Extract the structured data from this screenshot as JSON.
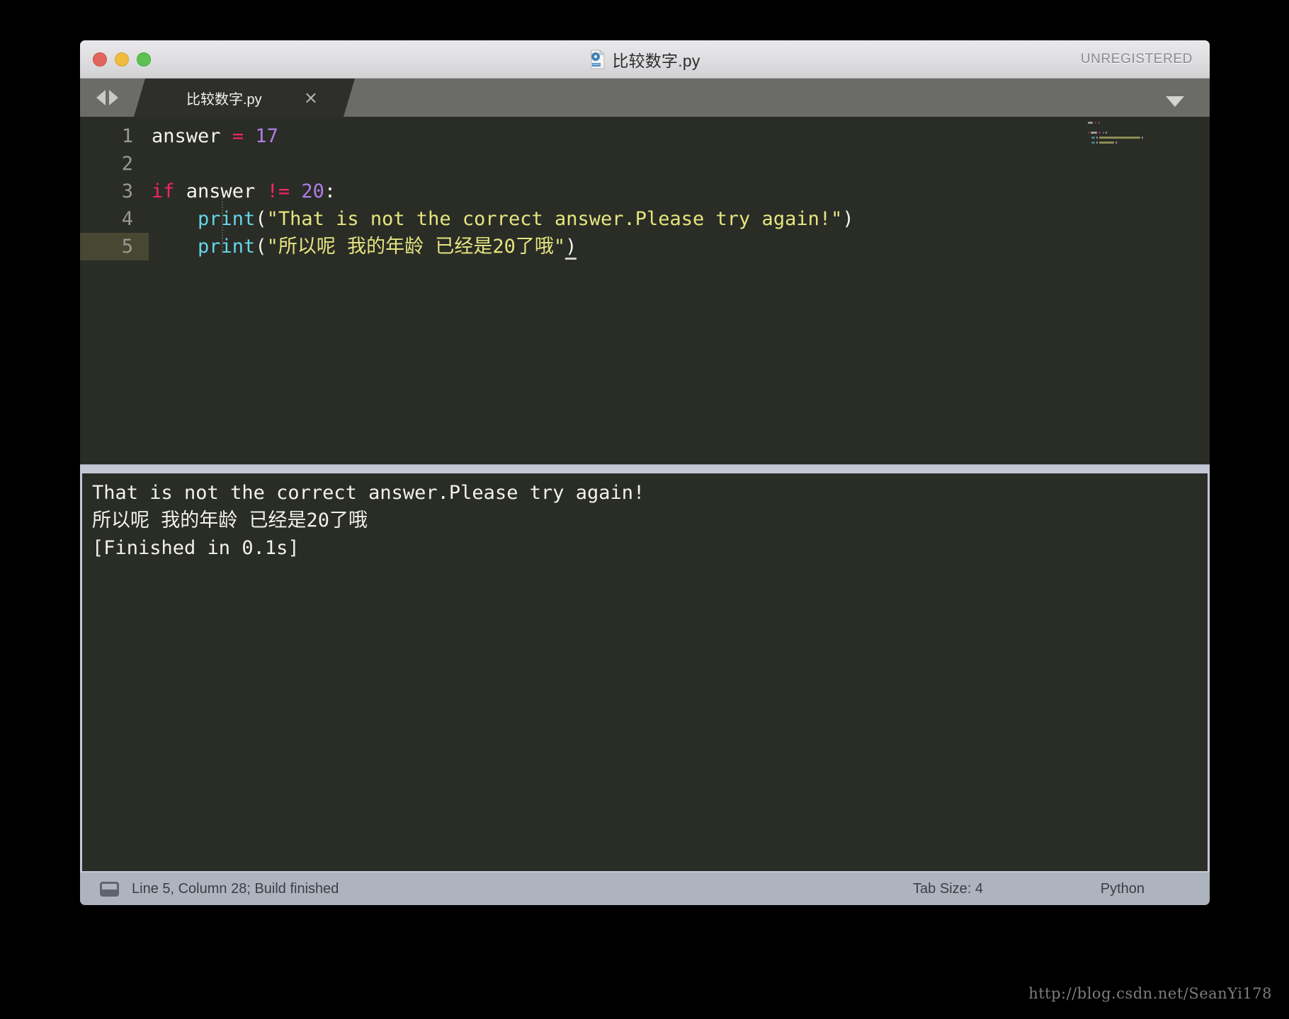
{
  "window": {
    "title": "比较数字.py",
    "license_badge": "UNREGISTERED",
    "file_icon": "python-file-icon",
    "traffic_lights": {
      "close": "close-window-button",
      "minimize": "minimize-window-button",
      "maximize": "maximize-window-button"
    },
    "colors": {
      "titlebar_top": "#e9e8ea",
      "titlebar_bottom": "#d2d1d4",
      "tabbar": "#6b6b68",
      "editor_bg": "#2a2c26",
      "splitter": "#c4c7d4",
      "statusbar": "#aeb4be"
    }
  },
  "tabbar": {
    "nav_back": "◀",
    "nav_forward": "▶",
    "tab_label": "比较数字.py",
    "close_label": "×",
    "dropdown": "▼"
  },
  "editor": {
    "active_line": 5,
    "line_numbers": [
      "1",
      "2",
      "3",
      "4",
      "5"
    ],
    "lines": [
      {
        "n": "1",
        "tokens": [
          {
            "t": "answer",
            "c": "plain"
          },
          {
            "t": " ",
            "c": "plain"
          },
          {
            "t": "=",
            "c": "op"
          },
          {
            "t": " ",
            "c": "plain"
          },
          {
            "t": "17",
            "c": "num"
          }
        ]
      },
      {
        "n": "2",
        "tokens": []
      },
      {
        "n": "3",
        "tokens": [
          {
            "t": "if",
            "c": "kw"
          },
          {
            "t": " answer ",
            "c": "plain"
          },
          {
            "t": "!=",
            "c": "op"
          },
          {
            "t": " ",
            "c": "plain"
          },
          {
            "t": "20",
            "c": "num"
          },
          {
            "t": ":",
            "c": "punc"
          }
        ]
      },
      {
        "n": "4",
        "tokens": [
          {
            "t": "    ",
            "c": "plain"
          },
          {
            "t": "print",
            "c": "fn"
          },
          {
            "t": "(",
            "c": "punc"
          },
          {
            "t": "\"That is not the correct answer.Please try again!\"",
            "c": "str"
          },
          {
            "t": ")",
            "c": "punc"
          }
        ]
      },
      {
        "n": "5",
        "tokens": [
          {
            "t": "    ",
            "c": "plain"
          },
          {
            "t": "print",
            "c": "fn"
          },
          {
            "t": "(",
            "c": "punc"
          },
          {
            "t": "\"所以呢 我的年龄 已经是20了哦\"",
            "c": "str"
          },
          {
            "t": ")",
            "c": "punc"
          }
        ]
      }
    ],
    "syntax_colors": {
      "plain": "#f4f4ef",
      "operator": "#f4256c",
      "number": "#ad7fe8",
      "keyword": "#f4256c",
      "function": "#64d6e8",
      "string": "#e6e57f"
    }
  },
  "console": {
    "output_lines": [
      "That is not the correct answer.Please try again!",
      "所以呢 我的年龄 已经是20了哦",
      "[Finished in 0.1s]"
    ]
  },
  "statusbar": {
    "toggle_icon": "console-toggle-icon",
    "position_text": "Line 5, Column 28; Build finished",
    "tab_size": "Tab Size: 4",
    "syntax_mode": "Python"
  },
  "watermark": {
    "text": "http://blog.csdn.net/SeanYi178"
  }
}
